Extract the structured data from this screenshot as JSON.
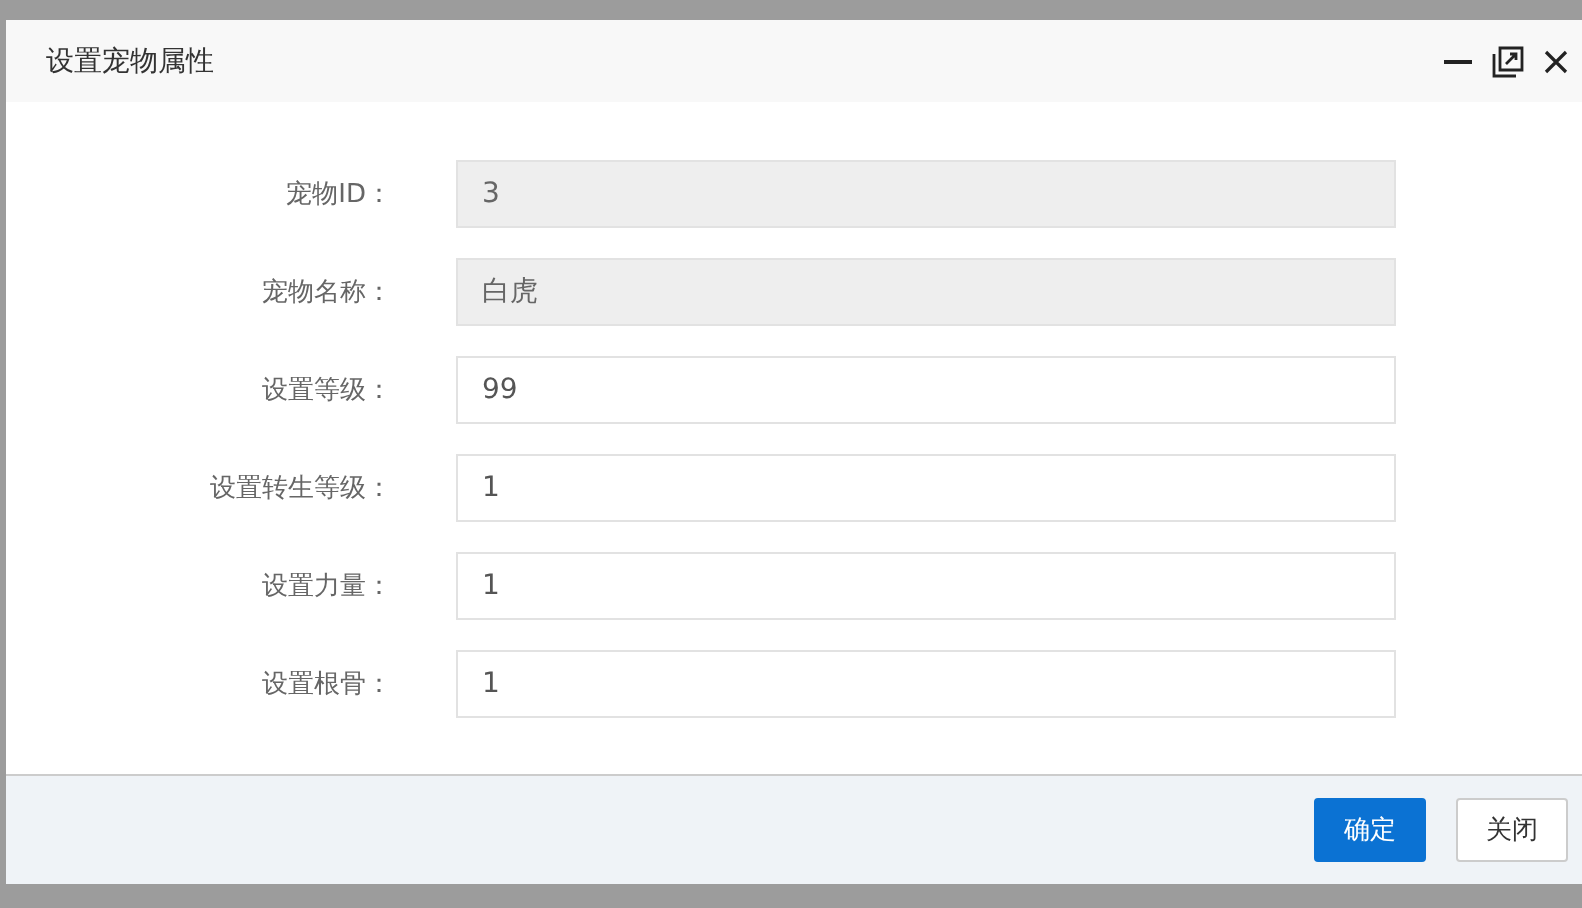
{
  "dialog": {
    "title": "设置宠物属性"
  },
  "fields": [
    {
      "label": "宠物ID：",
      "value": "3",
      "disabled": true
    },
    {
      "label": "宠物名称：",
      "value": "白虎",
      "disabled": true
    },
    {
      "label": "设置等级：",
      "value": "99",
      "disabled": false
    },
    {
      "label": "设置转生等级：",
      "value": "1",
      "disabled": false
    },
    {
      "label": "设置力量：",
      "value": "1",
      "disabled": false
    },
    {
      "label": "设置根骨：",
      "value": "1",
      "disabled": false
    }
  ],
  "buttons": [
    {
      "label": "确定",
      "kind": "primary"
    },
    {
      "label": "关闭",
      "kind": "secondary"
    }
  ]
}
